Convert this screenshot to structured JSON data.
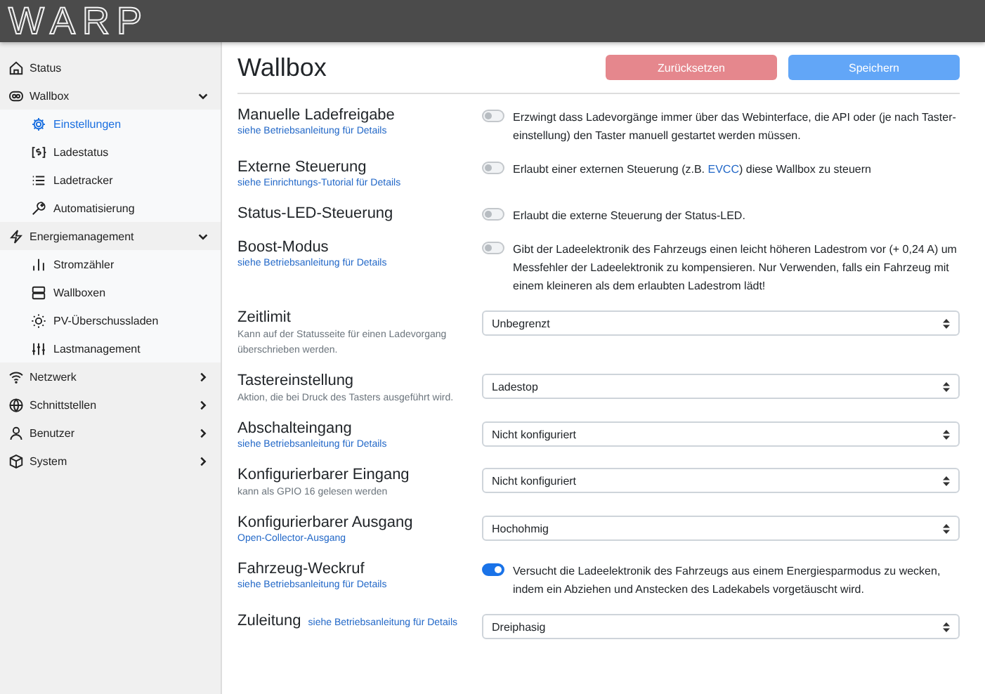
{
  "header": {
    "logo": "WARP"
  },
  "sidebar": {
    "items": [
      {
        "label": "Status",
        "selected": false
      },
      {
        "label": "Wallbox",
        "selected": false,
        "expanded": true,
        "children": [
          {
            "label": "Einstellungen",
            "selected": true
          },
          {
            "label": "Ladestatus",
            "selected": false
          },
          {
            "label": "Ladetracker",
            "selected": false
          },
          {
            "label": "Automatisierung",
            "selected": false
          }
        ]
      },
      {
        "label": "Energiemanagement",
        "selected": false,
        "expanded": true,
        "children": [
          {
            "label": "Stromzähler",
            "selected": false
          },
          {
            "label": "Wallboxen",
            "selected": false
          },
          {
            "label": "PV-Überschussladen",
            "selected": false
          },
          {
            "label": "Lastmanagement",
            "selected": false
          }
        ]
      },
      {
        "label": "Netzwerk",
        "selected": false,
        "expanded": false
      },
      {
        "label": "Schnittstellen",
        "selected": false,
        "expanded": false
      },
      {
        "label": "Benutzer",
        "selected": false,
        "expanded": false
      },
      {
        "label": "System",
        "selected": false,
        "expanded": false
      }
    ]
  },
  "page": {
    "title": "Wallbox",
    "buttons": [
      {
        "label": "Zurücksetzen",
        "kind": "reset"
      },
      {
        "label": "Speichern",
        "kind": "save"
      }
    ]
  },
  "settings": [
    {
      "label": "Manuelle Ladefreigabe",
      "link": "siehe Betriebsanleitung für Details",
      "kind": "switch",
      "on": false,
      "description": [
        {
          "text": "Erzwingt dass Ladevorgänge immer über das Webinterface, die API oder (je nach Taster-einstellung) den Taster manuell gestartet werden müssen."
        }
      ]
    },
    {
      "label": "Externe Steuerung",
      "link": "siehe Einrichtungs-Tutorial für Details",
      "kind": "switch",
      "on": false,
      "description": [
        {
          "text": "Erlaubt einer externen Steuerung (z.B. "
        },
        {
          "text": "EVCC",
          "link": true
        },
        {
          "text": ") diese Wallbox zu steuern"
        }
      ]
    },
    {
      "label": "Status-LED-Steuerung",
      "kind": "switch",
      "on": false,
      "description": [
        {
          "text": "Erlaubt die externe Steuerung der Status-LED."
        }
      ]
    },
    {
      "label": "Boost-Modus",
      "link": "siehe Betriebsanleitung für Details",
      "kind": "switch",
      "on": false,
      "description": [
        {
          "text": "Gibt der Ladeelektronik des Fahrzeugs einen leicht höheren Ladestrom vor (+ 0,24 A) um Messfehler der Ladeelektronik zu kompensieren. Nur Verwenden, falls ein Fahrzeug mit einem kleineren als dem erlaubten Ladestrom lädt!"
        }
      ]
    },
    {
      "label": "Zeitlimit",
      "hint": "Kann auf der Statusseite für einen Ladevorgang überschrieben werden.",
      "kind": "select",
      "value": "Unbegrenzt"
    },
    {
      "label": "Tastereinstellung",
      "hint": "Aktion, die bei Druck des Tasters ausgeführt wird.",
      "kind": "select",
      "value": "Ladestop"
    },
    {
      "label": "Abschalteingang",
      "link": "siehe Betriebsanleitung für Details",
      "kind": "select",
      "value": "Nicht konfiguriert"
    },
    {
      "label": "Konfigurierbarer Eingang",
      "hint": "kann als GPIO 16 gelesen werden",
      "kind": "select",
      "value": "Nicht konfiguriert"
    },
    {
      "label": "Konfigurierbarer Ausgang",
      "link": "Open-Collector-Ausgang",
      "kind": "select",
      "value": "Hochohmig"
    },
    {
      "label": "Fahrzeug-Weckruf",
      "link": "siehe Betriebsanleitung für Details",
      "kind": "switch",
      "on": true,
      "description": [
        {
          "text": "Versucht die Ladeelektronik des Fahrzeugs aus einem Energiesparmodus zu wecken, indem ein Abziehen und Anstecken des Ladekabels vorgetäuscht wird."
        }
      ]
    },
    {
      "label": "Zuleitung",
      "link": "siehe Betriebsanleitung für Details",
      "link_inline": true,
      "kind": "select",
      "value": "Dreiphasig"
    }
  ]
}
